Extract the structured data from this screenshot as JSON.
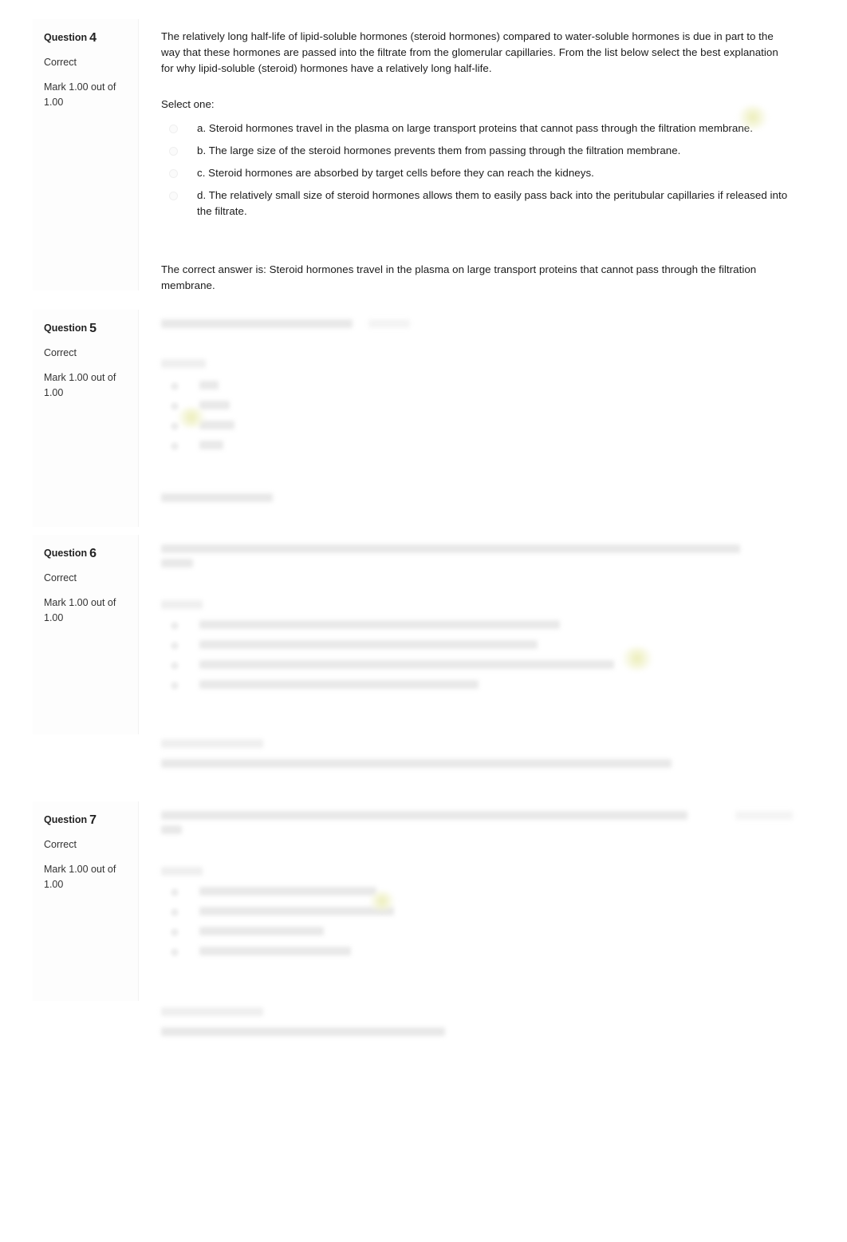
{
  "page": {
    "type": "quiz-review",
    "background_color": "#ffffff",
    "text_color": "#1b1b1b",
    "highlight_color": "#e8eaaa"
  },
  "questions": [
    {
      "id": "q4",
      "label": "Question",
      "number": "4",
      "state": "Correct",
      "grade": "Mark 1.00 out of 1.00",
      "redacted": false,
      "text": "The relatively long half-life of lipid-soluble hormones (steroid hormones) compared to water-soluble hormones is due in part to the way that these hormones are passed into the filtrate from the glomerular capillaries. From the list below select the best explanation for why lipid-soluble (steroid) hormones have a relatively long half-life.",
      "prompt": "Select one:",
      "options": [
        {
          "letter": "a.",
          "text": "a. Steroid hormones travel in the plasma on large transport proteins that cannot pass through the filtration membrane.",
          "selected": true
        },
        {
          "letter": "b.",
          "text": "b. The large size of the steroid hormones prevents them from passing through the filtration membrane.",
          "selected": false
        },
        {
          "letter": "c.",
          "text": "c. Steroid hormones are absorbed by target cells before they can reach the kidneys.",
          "selected": false
        },
        {
          "letter": "d.",
          "text": "d. The relatively small size of steroid hormones allows them to easily pass back into the peritubular capillaries if released into the filtrate.",
          "selected": false
        }
      ],
      "feedback": "The correct answer is: Steroid hormones travel in the plasma on large transport proteins that cannot pass through the filtration membrane."
    },
    {
      "id": "q5",
      "label": "Question",
      "number": "5",
      "state": "Correct",
      "grade": "Mark 1.00 out of 1.00",
      "redacted": true,
      "text": "",
      "prompt": "",
      "options": [
        {
          "letter": "",
          "text": "",
          "selected": false
        },
        {
          "letter": "",
          "text": "",
          "selected": false
        },
        {
          "letter": "",
          "text": "",
          "selected": true
        },
        {
          "letter": "",
          "text": "",
          "selected": false
        }
      ],
      "feedback": ""
    },
    {
      "id": "q6",
      "label": "Question",
      "number": "6",
      "state": "Correct",
      "grade": "Mark 1.00 out of 1.00",
      "redacted": true,
      "text": "",
      "prompt": "",
      "options": [
        {
          "letter": "",
          "text": "",
          "selected": false
        },
        {
          "letter": "",
          "text": "",
          "selected": false
        },
        {
          "letter": "",
          "text": "",
          "selected": true
        },
        {
          "letter": "",
          "text": "",
          "selected": false
        }
      ],
      "feedback": ""
    },
    {
      "id": "q7",
      "label": "Question",
      "number": "7",
      "state": "Correct",
      "grade": "Mark 1.00 out of 1.00",
      "redacted": true,
      "text": "",
      "prompt": "",
      "options": [
        {
          "letter": "",
          "text": "",
          "selected": false
        },
        {
          "letter": "",
          "text": "",
          "selected": true
        },
        {
          "letter": "",
          "text": "",
          "selected": false
        },
        {
          "letter": "",
          "text": "",
          "selected": false
        }
      ],
      "feedback": ""
    }
  ]
}
